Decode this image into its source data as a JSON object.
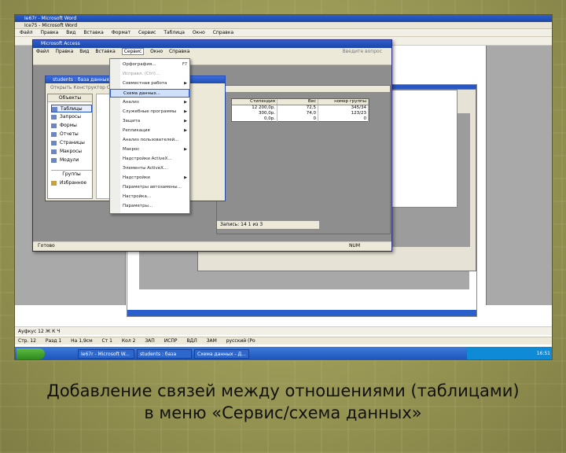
{
  "word": {
    "window_title": "Ie67r - Microsoft Word",
    "doc_title": "Ice75 - Microsoft Word",
    "menu": [
      "Файл",
      "Правка",
      "Вид",
      "Вставка",
      "Формат",
      "Сервис",
      "Таблица",
      "Окно",
      "Справка"
    ],
    "format_bar": "Ауфкус 12   Ж  К  Ч",
    "status": [
      "Стр. 12",
      "Разд 1",
      "На 1,9см",
      "Ст 1",
      "Кол 2",
      "ЗАП",
      "ИСПР",
      "ВДЛ",
      "ЗАМ",
      "русский (Ро"
    ],
    "taskbar": [
      "Ie67r - Microsoft W...",
      "students : база дан...",
      "Схема данных - Д..."
    ],
    "clock": "16:51"
  },
  "access": {
    "window_title": "Microsoft Access",
    "menu": [
      "Файл",
      "Правка",
      "Вид",
      "Вставка",
      "Сервис",
      "Окно",
      "Справка"
    ],
    "active_menu": "Сервис",
    "help_placeholder": "Введите вопрос",
    "status": "Готово",
    "status_right": "NUM"
  },
  "db_window": {
    "title": "students : база данных (формат...)",
    "toolbar": "Открыть  Конструктор  Создать",
    "objects_header": "Объекты",
    "objects": [
      "Таблицы",
      "Запросы",
      "Формы",
      "Отчеты",
      "Страницы",
      "Макросы",
      "Модули"
    ],
    "selected": "Таблицы",
    "groups_header": "Группы",
    "groups": [
      "Избранное"
    ]
  },
  "table_window": {
    "columns": [
      "Стипендия",
      "Вес",
      "номер группы"
    ],
    "rows": [
      [
        "12 200,0р.",
        "72,5",
        "345/34"
      ],
      [
        "300,0р.",
        "74,0",
        "123/23"
      ],
      [
        "0,0р.",
        "0",
        "0"
      ]
    ],
    "nav": "Запись:  14  1  из 3"
  },
  "service_menu": {
    "items": [
      {
        "label": "Орфография...",
        "shortcut": "F7"
      },
      {
        "label": "Исправл. (Ctrl)...",
        "dim": true
      },
      {
        "label": "Совместная работа",
        "sub": true
      },
      {
        "label": "Схема данных...",
        "hi": true
      },
      {
        "label": "Анализ",
        "sub": true
      },
      {
        "label": "Служебные программы",
        "sub": true
      },
      {
        "label": "Защита",
        "sub": true
      },
      {
        "label": "Репликация",
        "sub": true
      },
      {
        "label": "Анализ пользователей..."
      },
      {
        "label": "Макрос",
        "sub": true
      },
      {
        "label": "Надстройки ActiveX..."
      },
      {
        "label": "Элементы ActiveX..."
      },
      {
        "label": "Надстройки",
        "sub": true
      },
      {
        "label": "Параметры автозамены..."
      },
      {
        "label": "Настройка..."
      },
      {
        "label": "Параметры..."
      }
    ]
  },
  "caption": {
    "line1": "Добавление связей между отношениями (таблицами)",
    "line2": "в меню «Сервис/схема данных»"
  },
  "colors": {
    "background": "#9a9a52",
    "title_bar": "#1c46a8",
    "menu_highlight": "#cfe0fb"
  }
}
